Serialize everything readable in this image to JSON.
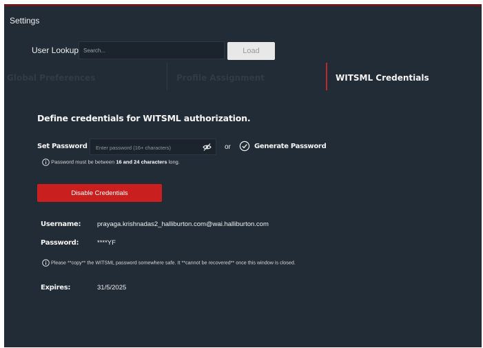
{
  "window": {
    "title": "Settings"
  },
  "user_lookup": {
    "label": "User Lookup",
    "placeholder": "Search...",
    "load_label": "Load"
  },
  "tabs": [
    {
      "label": "Global Preferences",
      "active": false
    },
    {
      "label": "Profile Assignment",
      "active": false
    },
    {
      "label": "WITSML Credentials",
      "active": true
    }
  ],
  "witsml": {
    "heading": "Define credentials for WITSML authorization.",
    "set_password_label": "Set Password",
    "password_placeholder": "Enter password (16+ characters)",
    "or_text": "or",
    "generate_password_label": "Generate Password",
    "generate_password_checked": true,
    "hint_prefix": "Password must be between ",
    "hint_emphasis": "16 and 24 characters",
    "hint_suffix": " long.",
    "disable_button_label": "Disable Credentials",
    "username_label": "Username:",
    "username_value": "prayaga.krishnadas2_halliburton.com@wai.halliburton.com",
    "password_label": "Password:",
    "password_value": "****YF",
    "copy_hint": "Please **copy** the WITSML password somewhere safe. It **cannot be recovered** once this window is closed.",
    "expires_label": "Expires:",
    "expires_value": "31/5/2025"
  },
  "colors": {
    "panel_background": "#222c36",
    "accent_red": "#c9201f",
    "active_tab_indicator": "#c0282a"
  },
  "icons": [
    "eye-off-icon",
    "checkbox-checked-icon",
    "info-icon"
  ]
}
